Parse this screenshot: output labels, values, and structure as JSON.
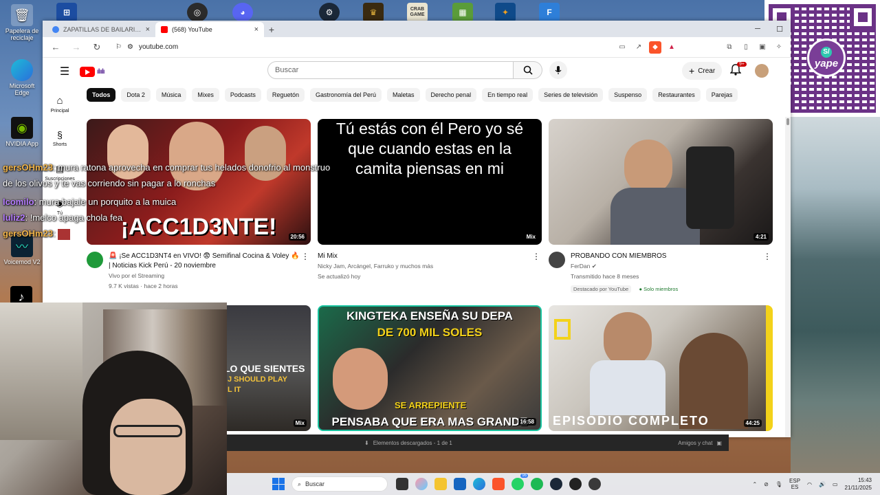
{
  "desktop": {
    "icons": [
      {
        "label": "Papelera de reciclaje",
        "icon": "recycle-bin-icon"
      },
      {
        "label": "Microsoft Edge",
        "icon": "edge-icon"
      },
      {
        "label": "NVIDIA App",
        "icon": "nvidia-icon"
      },
      {
        "label": "Voicemod V2",
        "icon": "voicemod-icon"
      }
    ],
    "top_icons": [
      "obs-icon",
      "discord-icon",
      "steam-icon",
      "game-icon",
      "crab-game-icon",
      "minecraft-icon",
      "counter-strike-icon",
      "fortnite-icon"
    ],
    "crab_game_label": "CRAB GAME",
    "fortnite_letter": "F"
  },
  "qr": {
    "brand": "yape",
    "logo_letter": "S/"
  },
  "browser": {
    "tabs": [
      {
        "title": "ZAPATILLAS DE BAILARIN DE TIJERAS",
        "active": false,
        "color": "#4285f4"
      },
      {
        "title": "(568) YouTube",
        "active": true,
        "color": "#ff0000"
      }
    ],
    "new_tab": "+",
    "url": "youtube.com"
  },
  "youtube": {
    "search_placeholder": "Buscar",
    "create_label": "Crear",
    "notifications_badge": "9+",
    "sidebar": [
      {
        "label": "Principal",
        "icon": "home-icon"
      },
      {
        "label": "Shorts",
        "icon": "shorts-icon"
      },
      {
        "label": "Suscripciones",
        "icon": "subscriptions-icon"
      },
      {
        "label": "Tú",
        "icon": "you-icon"
      }
    ],
    "chips": [
      "Todos",
      "Dota 2",
      "Música",
      "Mixes",
      "Podcasts",
      "Reguetón",
      "Gastronomía del Perú",
      "Maletas",
      "Derecho penal",
      "En tiempo real",
      "Series de televisión",
      "Suspenso",
      "Restaurantes",
      "Parejas"
    ],
    "videos": [
      {
        "thumb_text": "¡ACC1D3NTE!",
        "duration": "20:56",
        "title": "🚨 ¡Se ACC1D3NT4 en VIVO! 😨 Semifinal Cocina & Voley 🔥 | Noticias Kick Perú - 20 noviembre",
        "channel": "Vivo por el Streaming",
        "stats": "9.7 K vistas · hace 2 horas"
      },
      {
        "thumb_text": "Tú estás con él Pero yo sé que cuando estas en la camita piensas en mi",
        "duration": "Mix",
        "title": "Mi Mix",
        "channel": "Nicky Jam, Arcángel, Farruko y muchos más",
        "stats": "Se actualizó hoy"
      },
      {
        "thumb_text": "",
        "duration": "4:21",
        "title": "PROBANDO CON MIEMBROS",
        "channel": "FerDan",
        "stats": "Transmitido hace 8 meses",
        "pill1": "Destacado por YouTube",
        "pill2": "Solo miembros"
      },
      {
        "thumb_text": "LO QUE SIENTES",
        "thumb_text2": "J SHOULD PLAY",
        "thumb_text3": "L IT",
        "duration": "Mix"
      },
      {
        "thumb_text": "KINGTEKA ENSEÑA SU DEPA",
        "thumb_text2": "DE 700 MIL SOLES",
        "thumb_text3": "SE ARREPIENTE",
        "thumb_text4": "PENSABA QUE ERA MAS GRANDE",
        "duration": "16:58"
      },
      {
        "thumb_text": "EPISODIO COMPLETO",
        "duration": "44:25"
      }
    ]
  },
  "downloads_bar": {
    "text": "Elementos descargados - 1 de 1",
    "right": "Amigos y chat"
  },
  "chat": [
    {
      "user": "gersOHm23",
      "message": ": mura ratona aprovecha en comprar tus helados donofrio al monstruo de los olivos y te vas corriendo sin pagar a lo ronchas"
    },
    {
      "user": "Icomilo",
      "message": ": mura bajale un porquito a la muica"
    },
    {
      "user": "luliz2",
      "message": ": !melco apaga chola fea"
    },
    {
      "user": "gersOHm23",
      "message": ":"
    }
  ],
  "taskbar": {
    "search_label": "Buscar",
    "whatsapp_badge": "96",
    "lang_top": "ESP",
    "lang_bottom": "ES",
    "time": "15:43",
    "date": "21/11/2025"
  }
}
